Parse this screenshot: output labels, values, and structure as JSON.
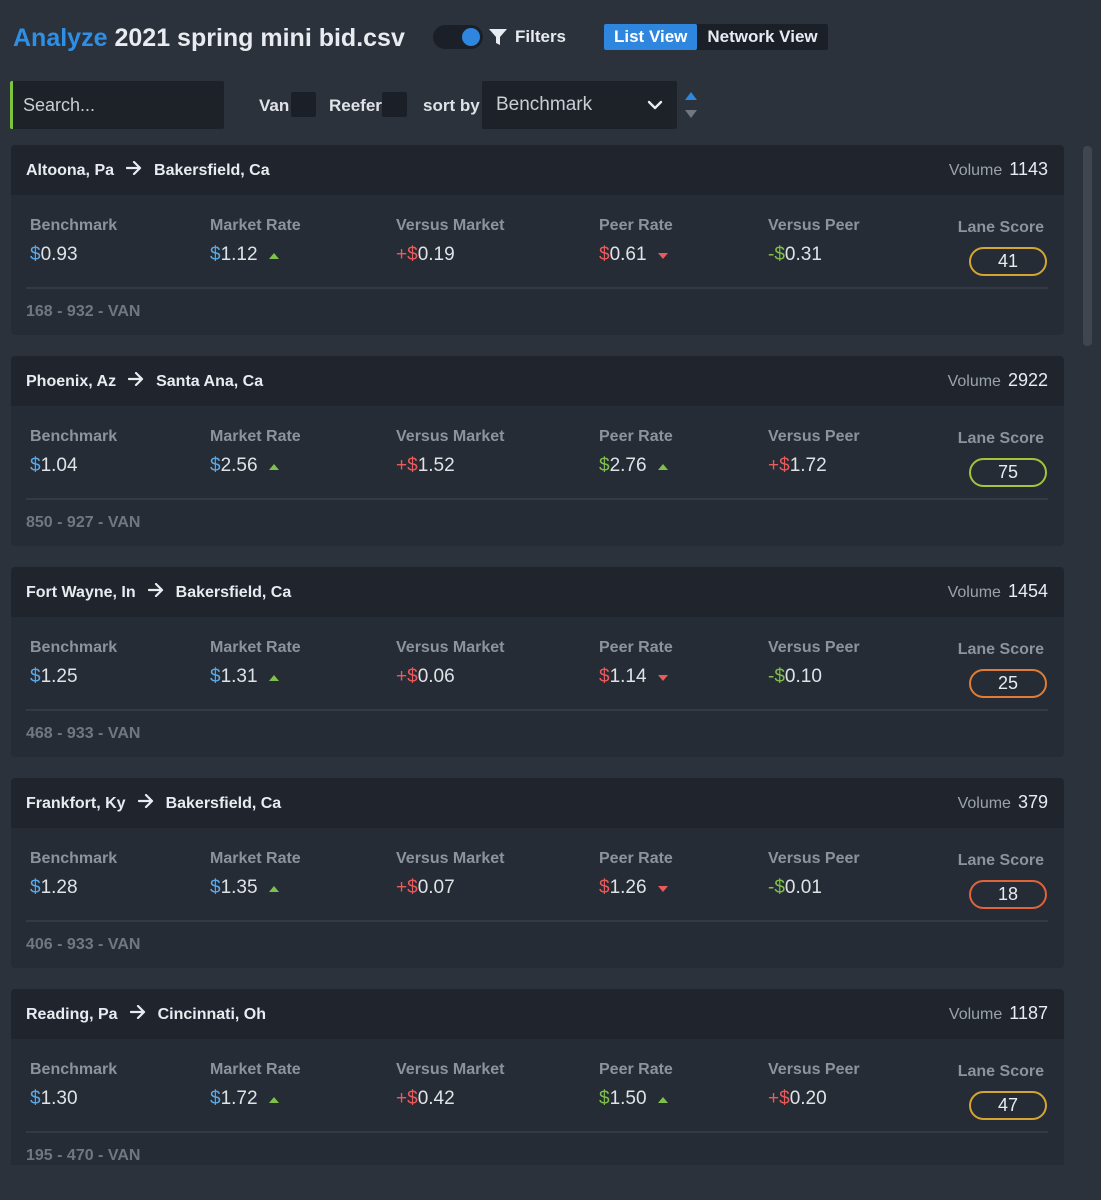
{
  "header": {
    "analyze_label": "Analyze",
    "file_name": "2021 spring mini bid.csv",
    "filters_label": "Filters",
    "tabs": [
      {
        "label": "List View",
        "active": true
      },
      {
        "label": "Network View",
        "active": false
      }
    ]
  },
  "controls": {
    "search_placeholder": "Search...",
    "van_label": "Van",
    "reefer_label": "Reefer",
    "sort_by_label": "sort by",
    "sort_value": "Benchmark"
  },
  "labels": {
    "volume": "Volume",
    "benchmark": "Benchmark",
    "market_rate": "Market Rate",
    "versus_market": "Versus Market",
    "peer_rate": "Peer Rate",
    "versus_peer": "Versus Peer",
    "lane_score": "Lane Score"
  },
  "colors": {
    "accent_blue": "#2e86de",
    "positive_green": "#7ec04a",
    "negative_red": "#e95a5a"
  },
  "lanes": [
    {
      "origin": "Altoona, Pa",
      "destination": "Bakersfield, Ca",
      "volume": "1143",
      "benchmark": "0.93",
      "market_rate": "1.12",
      "market_trend": "up",
      "versus_market_sign": "+",
      "versus_market": "0.19",
      "peer_rate": "0.61",
      "peer_trend": "down",
      "versus_peer_sign": "-",
      "versus_peer": "0.31",
      "lane_score": "41",
      "score_color": "#d6a531",
      "code": "168 - 932 - VAN"
    },
    {
      "origin": "Phoenix, Az",
      "destination": "Santa Ana, Ca",
      "volume": "2922",
      "benchmark": "1.04",
      "market_rate": "2.56",
      "market_trend": "up",
      "versus_market_sign": "+",
      "versus_market": "1.52",
      "peer_rate": "2.76",
      "peer_trend": "up",
      "versus_peer_sign": "+",
      "versus_peer": "1.72",
      "lane_score": "75",
      "score_color": "#a8c23a",
      "code": "850 - 927 - VAN"
    },
    {
      "origin": "Fort Wayne, In",
      "destination": "Bakersfield, Ca",
      "volume": "1454",
      "benchmark": "1.25",
      "market_rate": "1.31",
      "market_trend": "up",
      "versus_market_sign": "+",
      "versus_market": "0.06",
      "peer_rate": "1.14",
      "peer_trend": "down",
      "versus_peer_sign": "-",
      "versus_peer": "0.10",
      "lane_score": "25",
      "score_color": "#e07c35",
      "code": "468 - 933 - VAN"
    },
    {
      "origin": "Frankfort, Ky",
      "destination": "Bakersfield, Ca",
      "volume": "379",
      "benchmark": "1.28",
      "market_rate": "1.35",
      "market_trend": "up",
      "versus_market_sign": "+",
      "versus_market": "0.07",
      "peer_rate": "1.26",
      "peer_trend": "down",
      "versus_peer_sign": "-",
      "versus_peer": "0.01",
      "lane_score": "18",
      "score_color": "#e0643a",
      "code": "406 - 933 - VAN"
    },
    {
      "origin": "Reading, Pa",
      "destination": "Cincinnati, Oh",
      "volume": "1187",
      "benchmark": "1.30",
      "market_rate": "1.72",
      "market_trend": "up",
      "versus_market_sign": "+",
      "versus_market": "0.42",
      "peer_rate": "1.50",
      "peer_trend": "up",
      "versus_peer_sign": "+",
      "versus_peer": "0.20",
      "lane_score": "47",
      "score_color": "#d6a531",
      "code": "195 - 470 - VAN"
    }
  ]
}
